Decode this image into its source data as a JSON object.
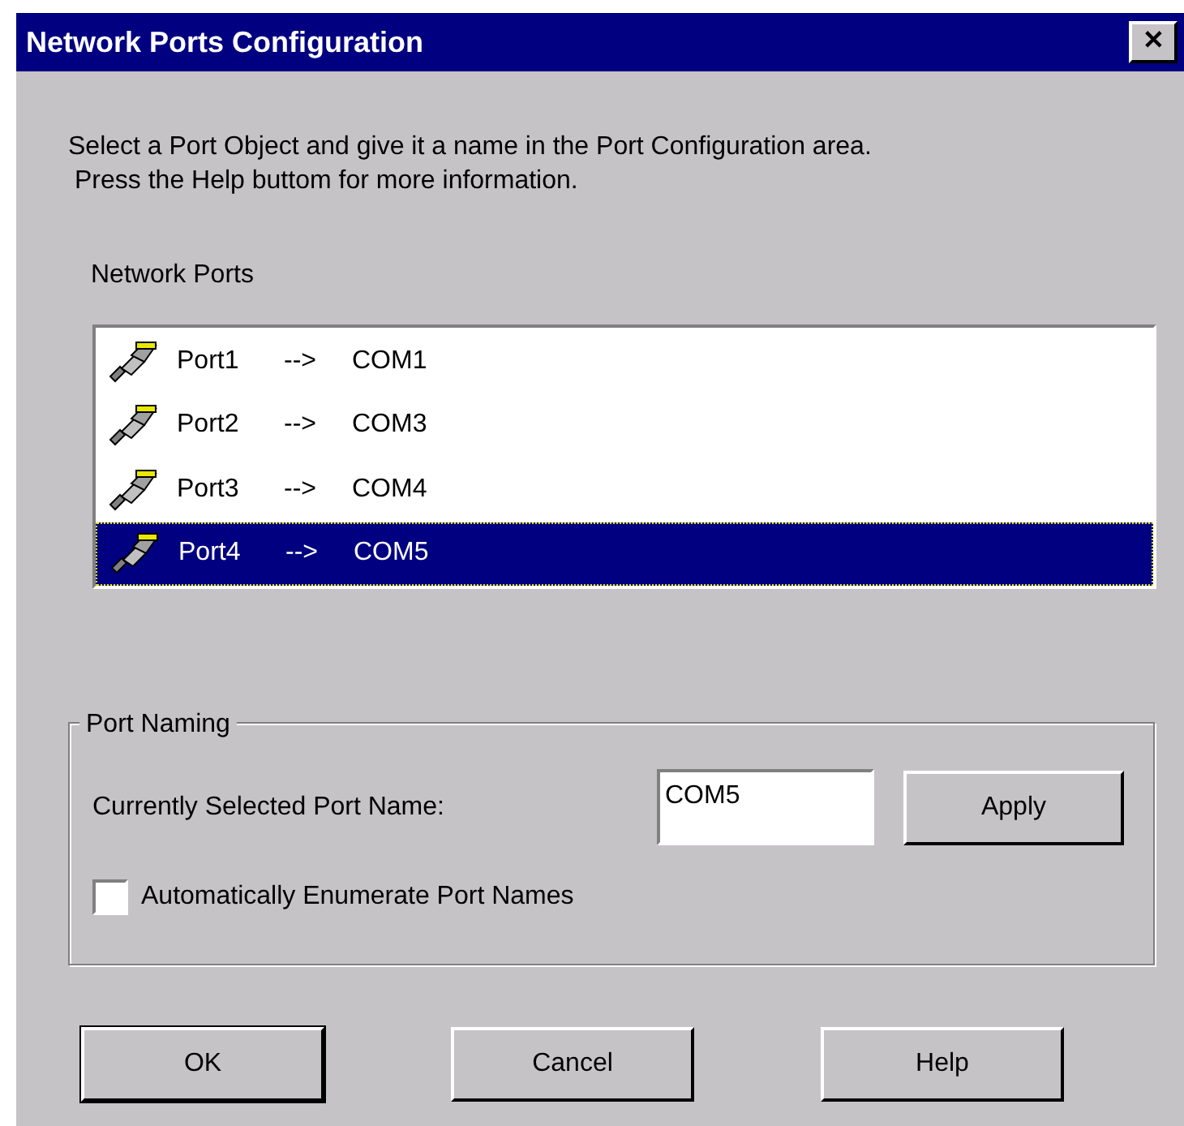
{
  "window": {
    "title": "Network Ports Configuration",
    "close_glyph": "✕"
  },
  "instructions": [
    "Select a Port Object and give it a name in the Port Configuration area.",
    "Press the Help buttom for more information."
  ],
  "ports_label": "Network Ports",
  "ports": [
    {
      "name": "Port1",
      "arrow": "-->",
      "com": "COM1",
      "selected": false
    },
    {
      "name": "Port2",
      "arrow": "-->",
      "com": "COM3",
      "selected": false
    },
    {
      "name": "Port3",
      "arrow": "-->",
      "com": "COM4",
      "selected": false
    },
    {
      "name": "Port4",
      "arrow": "-->",
      "com": "COM5",
      "selected": true
    }
  ],
  "port_naming": {
    "legend": "Port Naming",
    "name_label": "Currently Selected Port Name:",
    "name_value": "COM5",
    "apply": "Apply",
    "auto_enumerate": {
      "label": "Automatically Enumerate Port Names",
      "checked": false
    }
  },
  "buttons": [
    "OK",
    "Cancel",
    "Help"
  ]
}
